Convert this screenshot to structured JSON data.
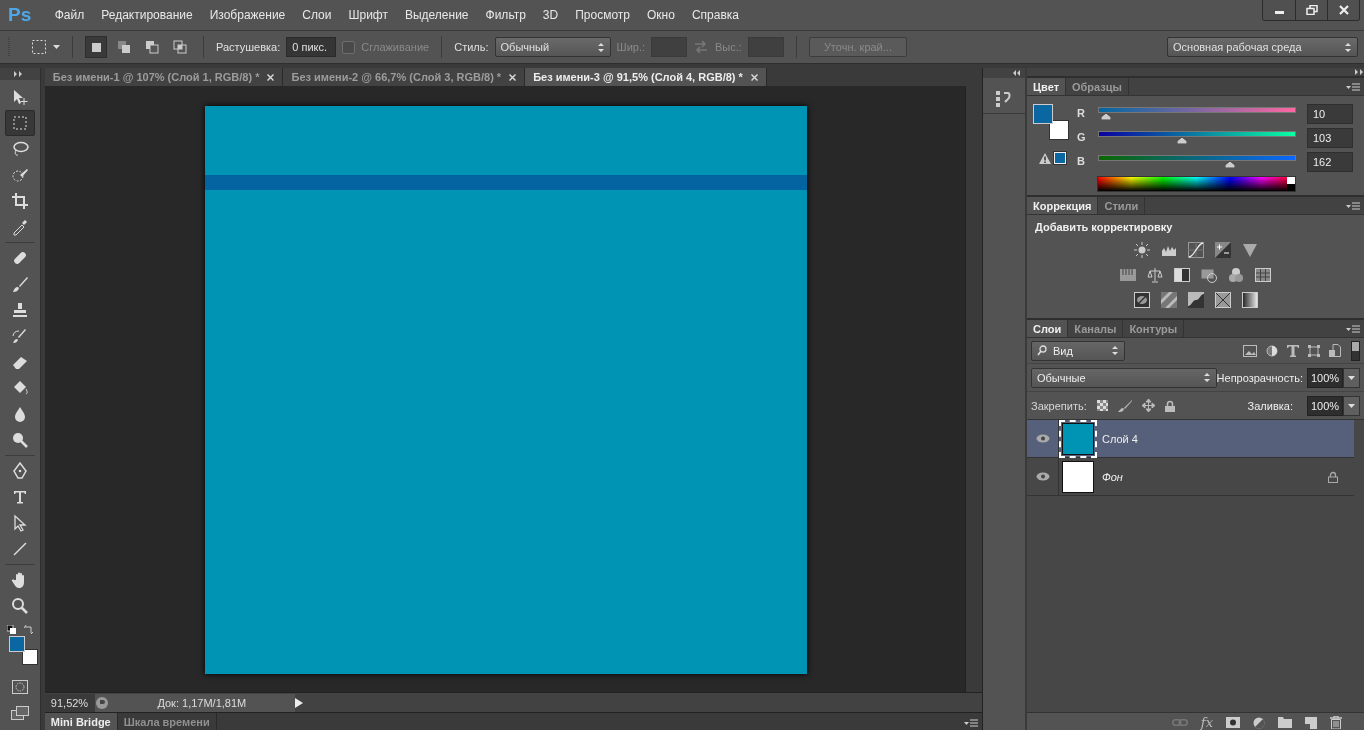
{
  "menubar": {
    "logo": "Ps",
    "items": [
      "Файл",
      "Редактирование",
      "Изображение",
      "Слои",
      "Шрифт",
      "Выделение",
      "Фильтр",
      "3D",
      "Просмотр",
      "Окно",
      "Справка"
    ]
  },
  "options": {
    "modes": [
      {
        "selected": true
      },
      {
        "selected": false
      },
      {
        "selected": false
      },
      {
        "selected": false
      }
    ],
    "feather": {
      "label": "Растушевка:",
      "value": "0 пикс."
    },
    "antialias": {
      "label": "Сглаживание",
      "checked": false,
      "disabled": true
    },
    "style": {
      "label": "Стиль:",
      "value": "Обычный"
    },
    "width": {
      "label": "Шир.:",
      "disabled": true
    },
    "height": {
      "label": "Выс.:",
      "disabled": true
    },
    "refine_edge": {
      "label": "Уточн. край...",
      "disabled": true
    },
    "workspace": "Основная рабочая среда"
  },
  "tools": [
    {
      "selected": false
    },
    {
      "selected": true
    },
    {
      "selected": false
    },
    {
      "selected": false
    },
    {
      "selected": false
    },
    {
      "selected": false
    },
    {
      "selected": false
    },
    {
      "selected": false
    },
    {
      "selected": false
    },
    {
      "selected": false
    },
    {
      "selected": false
    },
    {
      "selected": false
    },
    {
      "selected": false
    },
    {
      "selected": false
    },
    {
      "selected": false
    },
    {
      "selected": false
    },
    {
      "selected": false
    },
    {
      "selected": false
    },
    {
      "selected": false
    },
    {
      "selected": false
    }
  ],
  "doc_tabs": [
    {
      "label": "Без имени-1 @ 107% (Слой 1, RGB/8) *",
      "selected": false
    },
    {
      "label": "Без имени-2 @ 66,7% (Слой 3, RGB/8) *",
      "selected": false
    },
    {
      "label": "Без имени-3 @ 91,5% (Слой 4, RGB/8) *",
      "selected": true
    }
  ],
  "status": {
    "zoom": "91,52%",
    "doc_info": "Док: 1,17M/1,81M"
  },
  "bottom_tabs": [
    {
      "label": "Mini Bridge",
      "selected": true
    },
    {
      "label": "Шкала времени",
      "selected": false
    }
  ],
  "color_panel": {
    "tabs": [
      {
        "label": "Цвет",
        "selected": true
      },
      {
        "label": "Образцы",
        "selected": false
      }
    ],
    "swatches": [
      {
        "kind": "foreground",
        "color": "#0a67a2"
      },
      {
        "kind": "background",
        "color": "#ffffff"
      }
    ],
    "channels": [
      {
        "label": "R",
        "value": "10",
        "level": 0.039
      },
      {
        "label": "G",
        "value": "103",
        "level": 0.404
      },
      {
        "label": "B",
        "value": "162",
        "level": 0.635
      }
    ]
  },
  "adjust_panel": {
    "tabs": [
      {
        "label": "Коррекция",
        "selected": true
      },
      {
        "label": "Стили",
        "selected": false
      }
    ],
    "heading": "Добавить корректировку"
  },
  "layers_panel": {
    "tabs": [
      {
        "label": "Слои",
        "selected": true
      },
      {
        "label": "Каналы",
        "selected": false
      },
      {
        "label": "Контуры",
        "selected": false
      }
    ],
    "filter": "Вид",
    "blend_mode": "Обычные",
    "opacity": {
      "label": "Непрозрачность:",
      "value": "100%"
    },
    "lock_label": "Закрепить:",
    "fill": {
      "label": "Заливка:",
      "value": "100%"
    },
    "layers": [
      {
        "name": "Слой 4",
        "kind": "layer",
        "selected": true,
        "visible": true,
        "locked": false,
        "color": "#0094b4"
      },
      {
        "name": "Фон",
        "kind": "background",
        "selected": false,
        "visible": true,
        "locked": true,
        "color": "#ffffff"
      }
    ],
    "fx_label": "fx"
  }
}
